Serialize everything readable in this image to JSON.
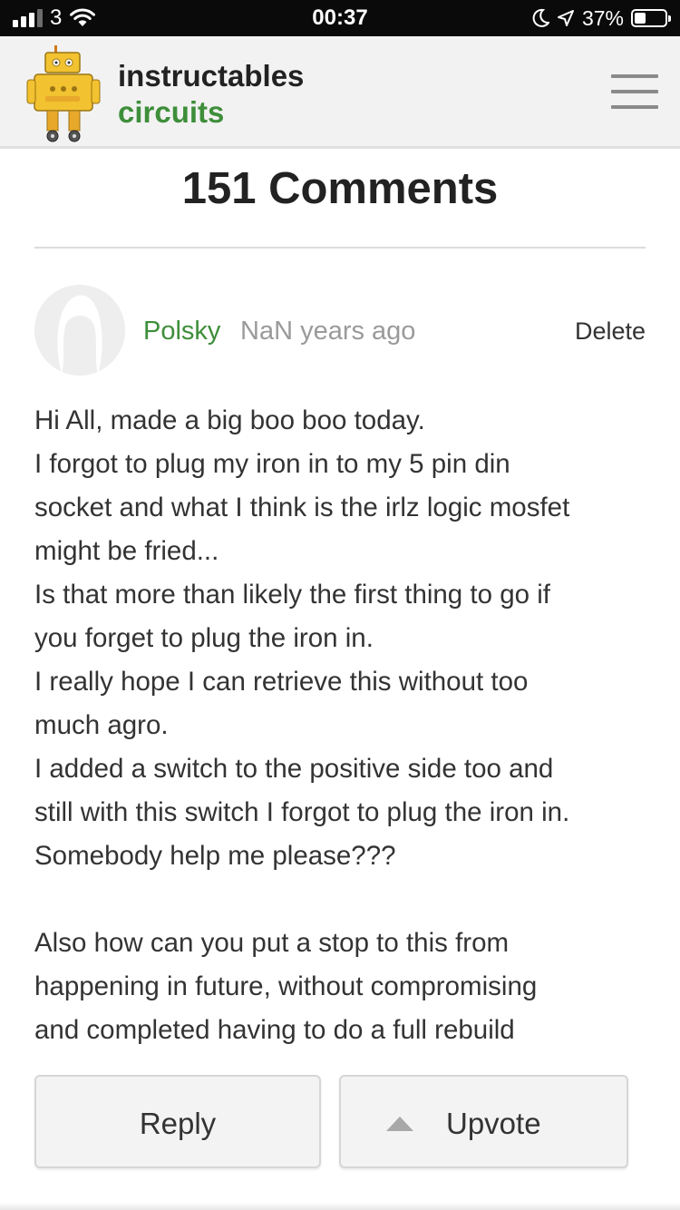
{
  "status_bar": {
    "carrier": "3",
    "time": "00:37",
    "battery_percent": "37%",
    "battery_level": 0.37,
    "signal_bars": 3,
    "icons": [
      "signal-icon",
      "wifi-icon",
      "moon-icon",
      "location-arrow-icon",
      "battery-icon"
    ]
  },
  "header": {
    "brand_name": "instructables",
    "brand_section": "circuits",
    "logo_icon": "robot-logo",
    "menu_icon": "hamburger-menu-icon"
  },
  "comments": {
    "title": "151 Comments",
    "items": [
      {
        "author": "Polsky",
        "time_ago": "NaN years ago",
        "delete_label": "Delete",
        "body_lines": [
          "Hi All, made a big boo boo today.",
          "I forgot to plug my iron in to my 5 pin din",
          "socket and what I think is the irlz logic mosfet",
          "might be fried...",
          "Is that more than likely the first thing to go if",
          "you forget to plug the iron in.",
          "I really hope I can retrieve this without too",
          "much agro.",
          "I added a switch to the positive side too and",
          "still with this switch I forgot to plug the iron in.",
          "Somebody help me please???",
          "",
          "Also how can you put a stop to this from",
          "happening in future, without compromising",
          "and completed having to do a full rebuild"
        ],
        "reply_label": "Reply",
        "upvote_label": "Upvote"
      }
    ]
  },
  "colors": {
    "brand_green": "#3e8e3a",
    "header_bg": "#f2f2f2",
    "robot_yellow": "#f2c230"
  }
}
